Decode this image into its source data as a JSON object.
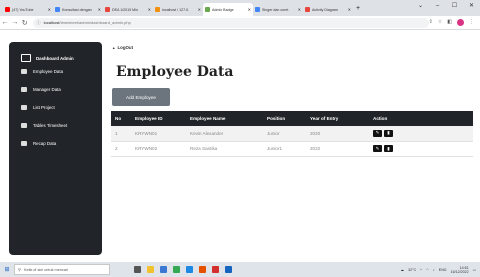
{
  "browser": {
    "tabs": [
      {
        "title": "(47) YouTube",
        "color": "#ff0000",
        "active": false
      },
      {
        "title": "Konsultasi dengan",
        "color": "#4285f4",
        "active": false
      },
      {
        "title": "DEA 1/2019 Min",
        "color": "#e8453c",
        "active": false
      },
      {
        "title": "localhost / 127.0.",
        "color": "#f29111",
        "active": false
      },
      {
        "title": "Admin Badge",
        "color": "#6aa84f",
        "active": true
      },
      {
        "title": "Singer dan coret",
        "color": "#4285f4",
        "active": false
      },
      {
        "title": "Activity Diagram",
        "color": "#e8453c",
        "active": false
      }
    ],
    "new_tab": "+",
    "url_host": "localhost",
    "url_path": "/timesheet/admin/dashboard_admin.php"
  },
  "sidebar": {
    "brand": "Dashboard Admin",
    "items": [
      {
        "label": "Employee Data"
      },
      {
        "label": "Manager Data"
      },
      {
        "label": "List Project"
      },
      {
        "label": "Tables Timesheet"
      },
      {
        "label": "Recap Data"
      }
    ]
  },
  "main": {
    "logout": "LogOut",
    "title": "Employee Data",
    "add_button": "Add Employee",
    "table": {
      "headers": [
        "No",
        "Employee ID",
        "Employee Name",
        "Position",
        "Year of Entry",
        "Action"
      ],
      "rows": [
        {
          "no": "1",
          "id": "KRYWN01",
          "name": "Kevin Alexander",
          "position": "Junior",
          "year": "2020"
        },
        {
          "no": "2",
          "id": "KRYWN02",
          "name": "Reza Santika",
          "position": "Junior1",
          "year": "2022"
        }
      ]
    }
  },
  "taskbar": {
    "search_placeholder": "Ketik di sini untuk mencari",
    "weather": "32°C",
    "lang": "ENG",
    "time": "14:51",
    "date": "16/12/2022"
  }
}
